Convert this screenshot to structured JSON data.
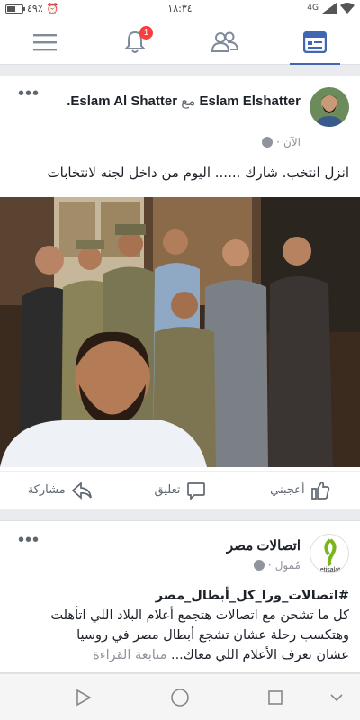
{
  "status_bar": {
    "network": "4G",
    "time": "١٨:٣٤",
    "battery": "٤٩٪",
    "battery_level": 0.49
  },
  "nav": {
    "items": [
      {
        "icon": "menu-icon"
      },
      {
        "icon": "bell-icon",
        "badge": "1"
      },
      {
        "icon": "friends-icon"
      },
      {
        "icon": "news-feed-icon",
        "active": true
      }
    ]
  },
  "post1": {
    "author_name": "Eslam Elshatter",
    "with_word": "مع",
    "tagged_name": "Eslam Al Shatter.",
    "time": "الآن",
    "separator": "·",
    "text": "انزل انتخب. شارك ...... اليوم  من داخل لجنه  لانتخابات",
    "photo_icon": "group-selfie-photo",
    "actions": {
      "like": "أعجبني",
      "comment": "تعليق",
      "share": "مشاركة"
    },
    "more_icon": "more-options-icon"
  },
  "post2": {
    "author_name": "اتصالات مصر",
    "avatar_text": "etisalat",
    "sponsored": "مُمول",
    "separator": "·",
    "hashtag": "#اتصالات_ورا_كل_أبطال_مصر",
    "line1": "كل ما تشحن مع اتصالات هتجمع أعلام البلاد اللي اتأهلت",
    "line2": "وهتكسب رحلة عشان تشجع أبطال مصر في روسيا",
    "line3": "عشان تعرف الأعلام اللي معاك...",
    "read_more": "متابعة القراءة"
  },
  "colors": {
    "brand": "#4267b2",
    "badge": "#fa3e3e",
    "etisalat_green": "#7bb51c"
  }
}
